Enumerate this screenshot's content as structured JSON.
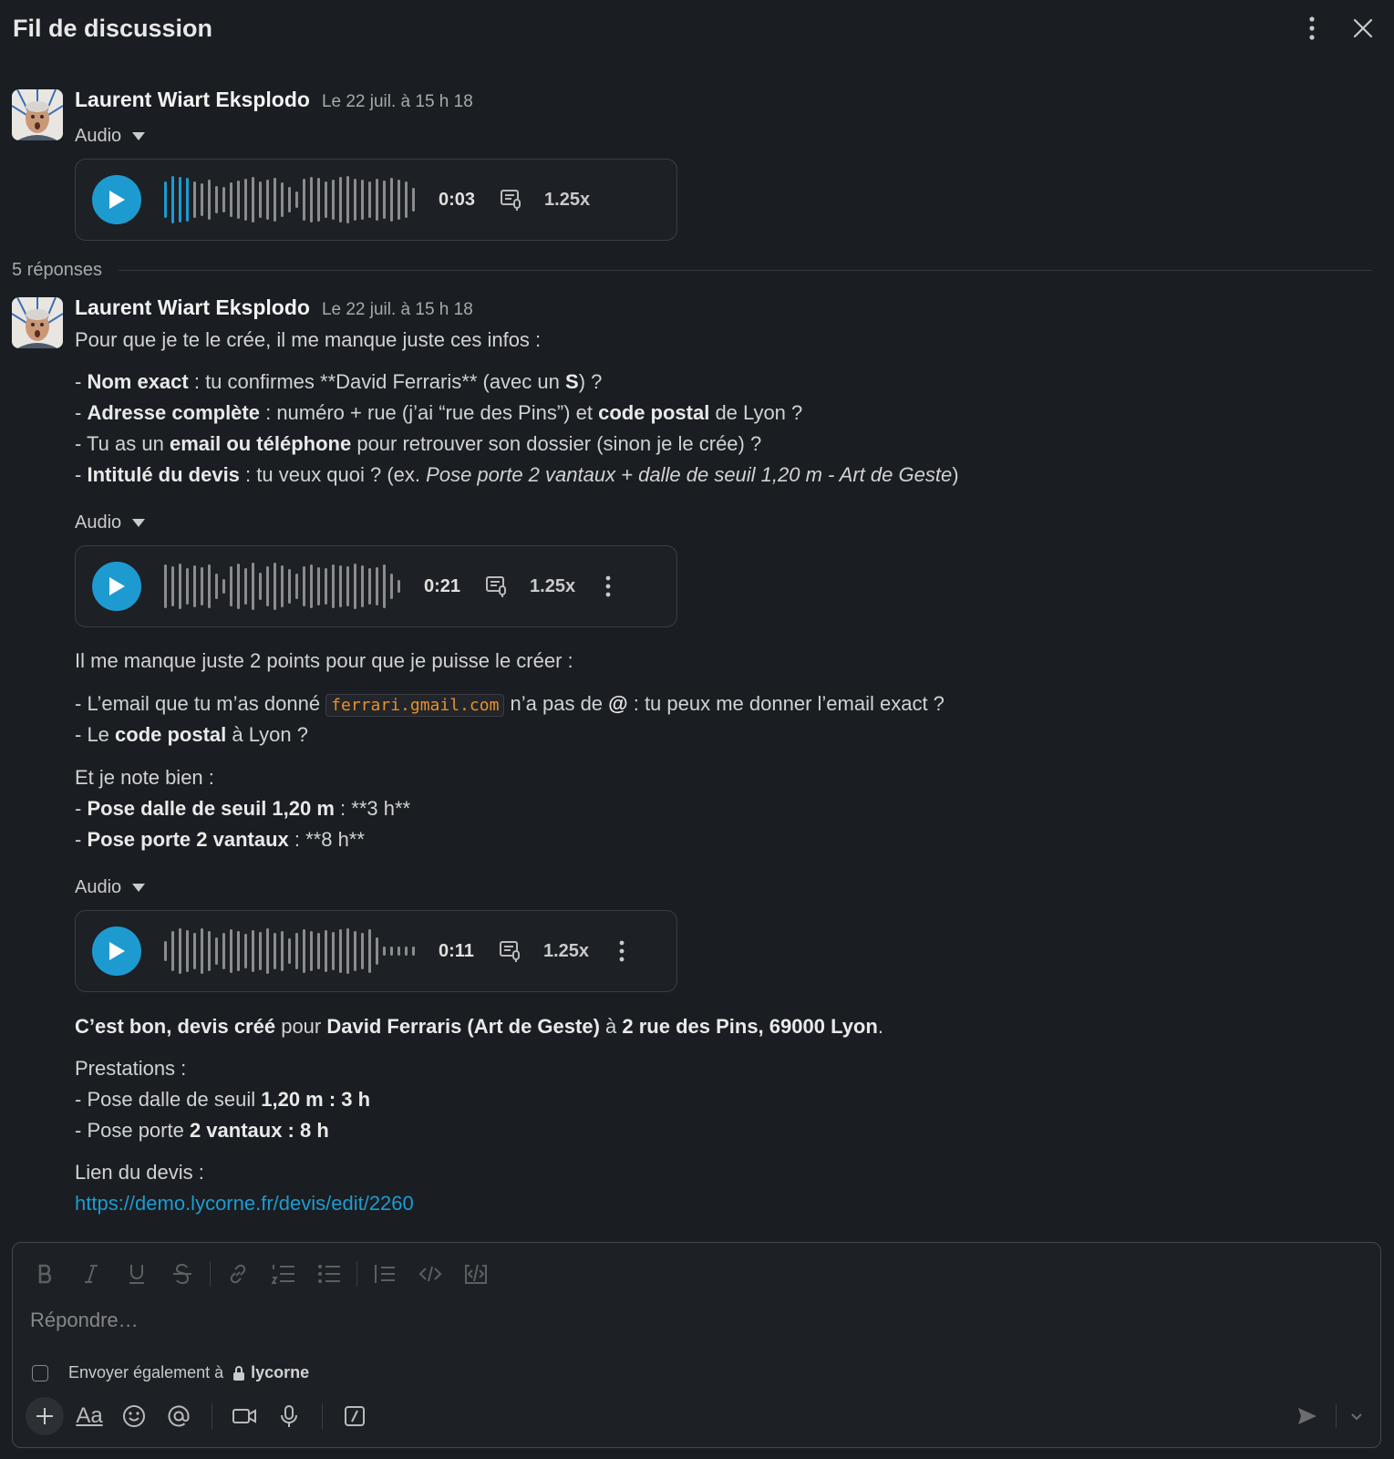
{
  "header": {
    "title": "Fil de discussion"
  },
  "colors": {
    "accent": "#1d9bd1",
    "background": "#1a1d21",
    "code": "#e8912d"
  },
  "parent": {
    "author": "Laurent Wiart Eksplodo",
    "timestamp": "Le 22 juil. à 15 h 18",
    "audio": {
      "label": "Audio",
      "duration": "0:03",
      "speed": "1.25x",
      "progress": 0.1
    }
  },
  "thread": {
    "replies_label": "5 réponses"
  },
  "reply": {
    "author": "Laurent Wiart Eksplodo",
    "timestamp": "Le 22 juil. à 15 h 18",
    "block1": {
      "intro": "Pour que je te le crée, il me manque juste ces infos :",
      "l1": {
        "p1": "- ",
        "b1": "Nom exact",
        "p2": " : tu confirmes **David Ferraris** (avec un ",
        "b2": "S",
        "p3": ") ?"
      },
      "l2": {
        "p1": "- ",
        "b1": "Adresse complète",
        "p2": " : numéro + rue (j’ai “rue des Pins”) et ",
        "b2": "code postal",
        "p3": " de Lyon ?"
      },
      "l3": {
        "p1": "- Tu as un ",
        "b1": "email ou téléphone",
        "p2": " pour retrouver son dossier (sinon je le crée) ?"
      },
      "l4": {
        "p1": "- ",
        "b1": "Intitulé du devis",
        "p2": " : tu veux quoi ? (ex. ",
        "i1": "Pose porte 2 vantaux + dalle de seuil 1,20 m - Art de Geste",
        "p3": ")"
      }
    },
    "audio2": {
      "label": "Audio",
      "duration": "0:21",
      "speed": "1.25x"
    },
    "block2": {
      "intro": "Il me manque juste 2 points pour que je puisse le créer :",
      "l1": {
        "p1": "- L’email que tu m’as donné ",
        "code": "ferrari.gmail.com",
        "p2": " n’a pas de ",
        "b1": "@",
        "p3": " : tu peux me donner l’email exact ?"
      },
      "l2": {
        "p1": "- Le ",
        "b1": "code postal",
        "p2": " à Lyon ?"
      },
      "note": "Et je note bien :",
      "l3": {
        "p1": "- ",
        "b1": "Pose dalle de seuil 1,20 m",
        "p2": " : **3 h**"
      },
      "l4": {
        "p1": "- ",
        "b1": "Pose porte 2 vantaux",
        "p2": " : **8 h**"
      }
    },
    "audio3": {
      "label": "Audio",
      "duration": "0:11",
      "speed": "1.25x"
    },
    "block3": {
      "l1": {
        "b1": "C’est bon, devis créé",
        "p1": " pour ",
        "b2": "David Ferraris (Art de Geste)",
        "p2": " à ",
        "b3": "2 rue des Pins, 69000 Lyon",
        "p3": "."
      },
      "presta": "Prestations :",
      "l2": {
        "p1": "- Pose dalle de seuil ",
        "b1": "1,20 m : 3 h"
      },
      "l3": {
        "p1": "- Pose porte ",
        "b1": "2 vantaux : 8 h"
      },
      "link_label": "Lien du devis :",
      "link": "https://demo.lycorne.fr/devis/edit/2260"
    }
  },
  "composer": {
    "placeholder": "Répondre…",
    "also_send_label": "Envoyer également à",
    "channel": "lycorne",
    "format_buttons": [
      "bold-icon",
      "italic-icon",
      "underline-icon",
      "strikethrough-icon",
      "link-icon",
      "ordered-list-icon",
      "bullet-list-icon",
      "blockquote-icon",
      "code-icon",
      "code-block-icon"
    ],
    "text_format_label": "Aa"
  }
}
